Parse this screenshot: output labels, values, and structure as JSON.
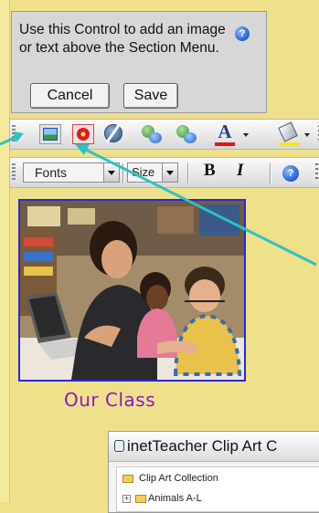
{
  "tooltip": {
    "text": "Use this Control to add an image or text above the Section Menu.",
    "cancel_label": "Cancel",
    "save_label": "Save",
    "help_glyph": "?"
  },
  "toolbar_top": {
    "font_color_letter": "A",
    "buttons": [
      "image-icon",
      "clip-art-icon",
      "hyperlink-icon",
      "people-icon",
      "people-add-icon",
      "font-color-icon",
      "highlight-color-icon"
    ]
  },
  "toolbar_format": {
    "fonts_label": "Fonts",
    "size_label": "Size",
    "bold_label": "B",
    "italic_label": "I",
    "help_glyph": "?"
  },
  "photo_caption": "Our Class",
  "clip_window": {
    "title": "inetTeacher Clip Art C",
    "items": [
      "Clip Art Collection",
      "Animals A-L"
    ]
  },
  "colors": {
    "background": "#efe08a",
    "arrow": "#2fc1c1",
    "caption": "#8a18c8",
    "photo_border": "#2a2ad0"
  }
}
